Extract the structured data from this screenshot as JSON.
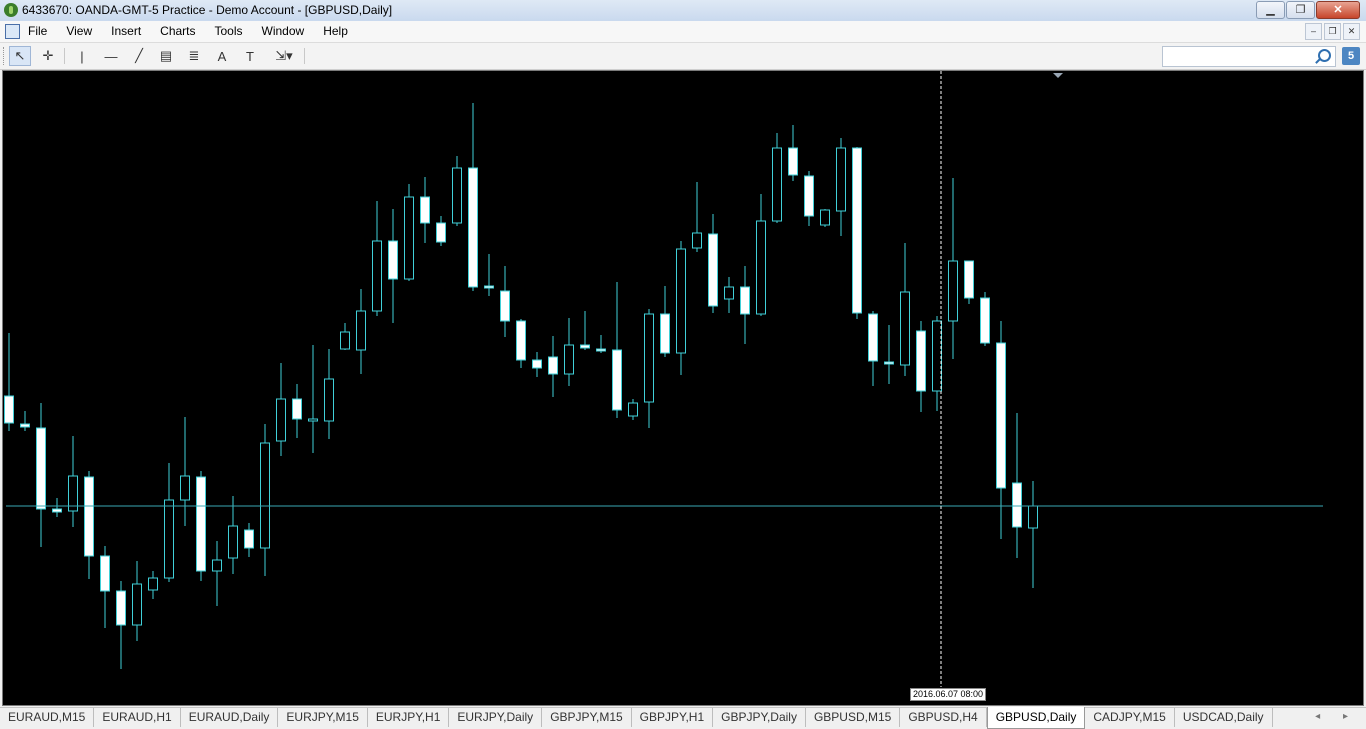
{
  "window": {
    "title": "6433670: OANDA-GMT-5 Practice - Demo Account - [GBPUSD,Daily]"
  },
  "window_buttons": {
    "minimize": "▁",
    "maximize": "❐",
    "close": "✕"
  },
  "menu": {
    "items": [
      "File",
      "View",
      "Insert",
      "Charts",
      "Tools",
      "Window",
      "Help"
    ]
  },
  "mdi_buttons": {
    "minimize": "–",
    "restore": "❐",
    "close": "✕"
  },
  "toolbar": {
    "tools": [
      {
        "name": "cursor-tool-icon",
        "glyph": "↖",
        "active": true
      },
      {
        "name": "crosshair-tool-icon",
        "glyph": "✛",
        "active": false
      },
      {
        "name": "vertical-line-tool-icon",
        "glyph": "|",
        "active": false
      },
      {
        "name": "horizontal-line-tool-icon",
        "glyph": "—",
        "active": false
      },
      {
        "name": "trendline-tool-icon",
        "glyph": "╱",
        "active": false
      },
      {
        "name": "equidistant-channel-tool-icon",
        "glyph": "▤",
        "active": false
      },
      {
        "name": "fibonacci-tool-icon",
        "glyph": "≣",
        "active": false
      },
      {
        "name": "text-tool-icon",
        "glyph": "A",
        "active": false
      },
      {
        "name": "text-label-tool-icon",
        "glyph": "T",
        "active": false
      },
      {
        "name": "arrows-tool-icon",
        "glyph": "⇲▾",
        "active": false
      }
    ],
    "search_value": "",
    "badge": "5"
  },
  "chart_data": {
    "type": "candlestick",
    "symbol": "GBPUSD",
    "timeframe": "Daily",
    "colors": {
      "background": "#000000",
      "bull_body": "#000000",
      "bear_body": "#ffffff",
      "wick": "#40d0d8",
      "grid_line": "#3aa9b5"
    },
    "crosshair_date_label": "2016.06.07 08:00",
    "candles": [
      {
        "o": 395,
        "c": 422,
        "h": 332,
        "l": 430
      },
      {
        "o": 423,
        "c": 426,
        "h": 410,
        "l": 430
      },
      {
        "o": 427,
        "c": 508,
        "h": 402,
        "l": 546
      },
      {
        "o": 508,
        "c": 511,
        "h": 497,
        "l": 516
      },
      {
        "o": 510,
        "c": 475,
        "h": 435,
        "l": 526
      },
      {
        "o": 476,
        "c": 555,
        "h": 470,
        "l": 578
      },
      {
        "o": 555,
        "c": 590,
        "h": 545,
        "l": 627
      },
      {
        "o": 590,
        "c": 624,
        "h": 580,
        "l": 668
      },
      {
        "o": 624,
        "c": 583,
        "h": 560,
        "l": 640
      },
      {
        "o": 589,
        "c": 577,
        "h": 570,
        "l": 598
      },
      {
        "o": 577,
        "c": 499,
        "h": 462,
        "l": 581
      },
      {
        "o": 499,
        "c": 475,
        "h": 416,
        "l": 525
      },
      {
        "o": 476,
        "c": 570,
        "h": 470,
        "l": 580
      },
      {
        "o": 570,
        "c": 559,
        "h": 540,
        "l": 605
      },
      {
        "o": 557,
        "c": 525,
        "h": 495,
        "l": 573
      },
      {
        "o": 529,
        "c": 547,
        "h": 522,
        "l": 556
      },
      {
        "o": 547,
        "c": 442,
        "h": 423,
        "l": 575
      },
      {
        "o": 440,
        "c": 398,
        "h": 362,
        "l": 455
      },
      {
        "o": 398,
        "c": 418,
        "h": 383,
        "l": 437
      },
      {
        "o": 420,
        "c": 418,
        "h": 344,
        "l": 452
      },
      {
        "o": 420,
        "c": 378,
        "h": 348,
        "l": 438
      },
      {
        "o": 348,
        "c": 331,
        "h": 322,
        "l": 349
      },
      {
        "o": 349,
        "c": 310,
        "h": 288,
        "l": 373
      },
      {
        "o": 310,
        "c": 240,
        "h": 200,
        "l": 315
      },
      {
        "o": 240,
        "c": 278,
        "h": 208,
        "l": 322
      },
      {
        "o": 278,
        "c": 196,
        "h": 183,
        "l": 280
      },
      {
        "o": 196,
        "c": 222,
        "h": 176,
        "l": 242
      },
      {
        "o": 222,
        "c": 241,
        "h": 215,
        "l": 245
      },
      {
        "o": 222,
        "c": 167,
        "h": 155,
        "l": 225
      },
      {
        "o": 167,
        "c": 286,
        "h": 102,
        "l": 290
      },
      {
        "o": 285,
        "c": 287,
        "h": 253,
        "l": 295
      },
      {
        "o": 290,
        "c": 320,
        "h": 265,
        "l": 336
      },
      {
        "o": 320,
        "c": 359,
        "h": 318,
        "l": 367
      },
      {
        "o": 359,
        "c": 367,
        "h": 351,
        "l": 376
      },
      {
        "o": 356,
        "c": 373,
        "h": 335,
        "l": 396
      },
      {
        "o": 373,
        "c": 344,
        "h": 317,
        "l": 385
      },
      {
        "o": 344,
        "c": 347,
        "h": 310,
        "l": 349
      },
      {
        "o": 348,
        "c": 349,
        "h": 334,
        "l": 352
      },
      {
        "o": 349,
        "c": 409,
        "h": 281,
        "l": 417
      },
      {
        "o": 415,
        "c": 402,
        "h": 398,
        "l": 419
      },
      {
        "o": 401,
        "c": 313,
        "h": 308,
        "l": 427
      },
      {
        "o": 313,
        "c": 352,
        "h": 285,
        "l": 356
      },
      {
        "o": 352,
        "c": 248,
        "h": 240,
        "l": 374
      },
      {
        "o": 247,
        "c": 232,
        "h": 181,
        "l": 251
      },
      {
        "o": 233,
        "c": 305,
        "h": 213,
        "l": 312
      },
      {
        "o": 298,
        "c": 286,
        "h": 276,
        "l": 312
      },
      {
        "o": 286,
        "c": 313,
        "h": 265,
        "l": 343
      },
      {
        "o": 313,
        "c": 220,
        "h": 193,
        "l": 315
      },
      {
        "o": 220,
        "c": 147,
        "h": 132,
        "l": 222
      },
      {
        "o": 147,
        "c": 174,
        "h": 124,
        "l": 180
      },
      {
        "o": 175,
        "c": 215,
        "h": 170,
        "l": 225
      },
      {
        "o": 224,
        "c": 209,
        "h": 208,
        "l": 226
      },
      {
        "o": 210,
        "c": 147,
        "h": 137,
        "l": 235
      },
      {
        "o": 147,
        "c": 312,
        "h": 146,
        "l": 318
      },
      {
        "o": 313,
        "c": 360,
        "h": 310,
        "l": 385
      },
      {
        "o": 361,
        "c": 362,
        "h": 324,
        "l": 383
      },
      {
        "o": 364,
        "c": 291,
        "h": 242,
        "l": 375
      },
      {
        "o": 330,
        "c": 390,
        "h": 320,
        "l": 411
      },
      {
        "o": 390,
        "c": 320,
        "h": 315,
        "l": 410
      },
      {
        "o": 320,
        "c": 260,
        "h": 177,
        "l": 358
      },
      {
        "o": 260,
        "c": 297,
        "h": 260,
        "l": 303
      },
      {
        "o": 297,
        "c": 342,
        "h": 291,
        "l": 345
      },
      {
        "o": 342,
        "c": 487,
        "h": 320,
        "l": 538
      },
      {
        "o": 482,
        "c": 526,
        "h": 412,
        "l": 557
      },
      {
        "o": 527,
        "c": 505,
        "h": 480,
        "l": 587
      }
    ],
    "current_price_line": 505,
    "crosshair_x_candle": 58,
    "grid": false
  },
  "tabs": [
    "EURAUD,M15",
    "EURAUD,H1",
    "EURAUD,Daily",
    "EURJPY,M15",
    "EURJPY,H1",
    "EURJPY,Daily",
    "GBPJPY,M15",
    "GBPJPY,H1",
    "GBPJPY,Daily",
    "GBPUSD,M15",
    "GBPUSD,H4",
    "GBPUSD,Daily",
    "CADJPY,M15",
    "USDCAD,Daily"
  ],
  "active_tab": "GBPUSD,Daily",
  "tab_scroll": "◂ ▸"
}
